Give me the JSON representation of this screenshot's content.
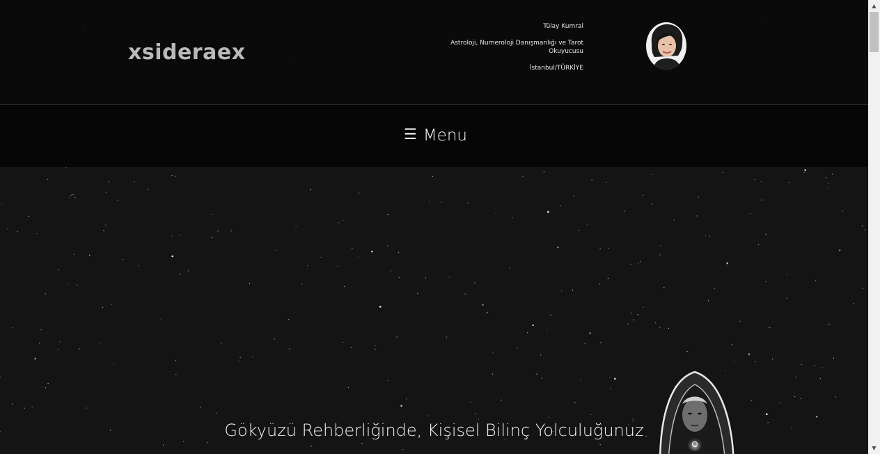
{
  "header": {
    "site_title": "xsideraex",
    "person_name": "Tülay Kumral",
    "profession": "Astroloji, Numeroloji Danışmanlığı ve Tarot Okuyucusu",
    "location": "İstanbul/TÜRKİYE"
  },
  "nav": {
    "menu_icon": "☰",
    "menu_label": "Menu"
  },
  "hero": {
    "title": "Gökyüzü Rehberliğinde, Kişisel Bilinç Yolculuğunuz"
  },
  "icons": {
    "menu": "hamburger-icon",
    "loader": "loader-icon",
    "scroll_up": "triangle-up",
    "scroll_down": "triangle-down"
  },
  "colors": {
    "background": "#0b0b0c",
    "hero_bg": "#141414",
    "title_gray": "#b9b9b9",
    "accent": "#c9885a"
  }
}
